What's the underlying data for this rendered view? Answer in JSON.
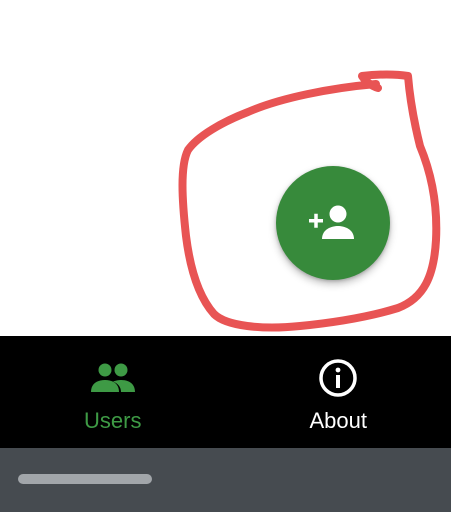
{
  "fab": {
    "icon": "person-add-icon",
    "color": "#378a3b"
  },
  "annotation": {
    "shape": "hand-drawn-circle",
    "color": "#e85454"
  },
  "bottom_nav": {
    "items": [
      {
        "label": "Users",
        "icon": "people-icon",
        "active": true,
        "color": "#3e9a45"
      },
      {
        "label": "About",
        "icon": "info-icon",
        "active": false,
        "color": "#ffffff"
      }
    ]
  },
  "system_bar": {
    "color": "#464b50",
    "handle_color": "#a2a6aa"
  }
}
